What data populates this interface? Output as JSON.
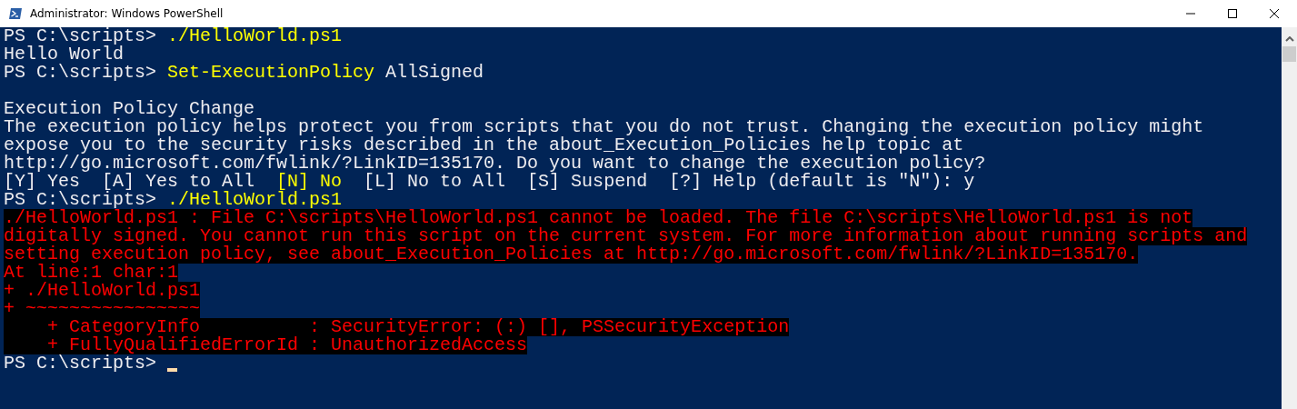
{
  "window": {
    "title": "Administrator: Windows PowerShell"
  },
  "terminal": {
    "cursor": true,
    "lines": [
      {
        "kind": "text",
        "segments": [
          {
            "kind": "prompt",
            "text": "PS C:\\scripts> "
          },
          {
            "kind": "command",
            "text": "./HelloWorld.ps1"
          }
        ]
      },
      {
        "kind": "text",
        "segments": [
          {
            "kind": "output",
            "text": "Hello World"
          }
        ]
      },
      {
        "kind": "text",
        "segments": [
          {
            "kind": "prompt",
            "text": "PS C:\\scripts> "
          },
          {
            "kind": "command",
            "text": "Set-ExecutionPolicy"
          },
          {
            "kind": "output",
            "text": " AllSigned"
          }
        ]
      },
      {
        "kind": "blank"
      },
      {
        "kind": "text",
        "segments": [
          {
            "kind": "output",
            "text": "Execution Policy Change"
          }
        ]
      },
      {
        "kind": "text",
        "segments": [
          {
            "kind": "output",
            "text": "The execution policy helps protect you from scripts that you do not trust. Changing the execution policy might"
          }
        ]
      },
      {
        "kind": "text",
        "segments": [
          {
            "kind": "output",
            "text": "expose you to the security risks described in the about_Execution_Policies help topic at"
          }
        ]
      },
      {
        "kind": "text",
        "segments": [
          {
            "kind": "output",
            "text": "http://go.microsoft.com/fwlink/?LinkID=135170. Do you want to change the execution policy?"
          }
        ]
      },
      {
        "kind": "text",
        "segments": [
          {
            "kind": "output",
            "text": "[Y] Yes  [A] Yes to All  "
          },
          {
            "kind": "command",
            "text": "[N] No"
          },
          {
            "kind": "output",
            "text": "  [L] No to All  [S] Suspend  [?] Help (default is \"N\"): y"
          }
        ]
      },
      {
        "kind": "text",
        "segments": [
          {
            "kind": "prompt",
            "text": "PS C:\\scripts> "
          },
          {
            "kind": "command",
            "text": "./HelloWorld.ps1"
          }
        ]
      },
      {
        "kind": "text",
        "segments": [
          {
            "kind": "error",
            "text": "./HelloWorld.ps1 : File C:\\scripts\\HelloWorld.ps1 cannot be loaded. The file C:\\scripts\\HelloWorld.ps1 is not"
          }
        ]
      },
      {
        "kind": "text",
        "segments": [
          {
            "kind": "error",
            "text": "digitally signed. You cannot run this script on the current system. For more information about running scripts and"
          }
        ]
      },
      {
        "kind": "text",
        "segments": [
          {
            "kind": "error",
            "text": "setting execution policy, see about_Execution_Policies at http://go.microsoft.com/fwlink/?LinkID=135170."
          }
        ]
      },
      {
        "kind": "text",
        "segments": [
          {
            "kind": "error",
            "text": "At line:1 char:1"
          }
        ]
      },
      {
        "kind": "text",
        "segments": [
          {
            "kind": "error",
            "text": "+ ./HelloWorld.ps1"
          }
        ]
      },
      {
        "kind": "text",
        "segments": [
          {
            "kind": "error",
            "text": "+ ~~~~~~~~~~~~~~~~"
          }
        ]
      },
      {
        "kind": "text",
        "segments": [
          {
            "kind": "error",
            "text": "    + CategoryInfo          : SecurityError: (:) [], PSSecurityException"
          }
        ]
      },
      {
        "kind": "text",
        "segments": [
          {
            "kind": "error",
            "text": "    + FullyQualifiedErrorId : UnauthorizedAccess"
          }
        ]
      },
      {
        "kind": "text",
        "segments": [
          {
            "kind": "prompt",
            "text": "PS C:\\scripts> "
          }
        ]
      }
    ]
  }
}
